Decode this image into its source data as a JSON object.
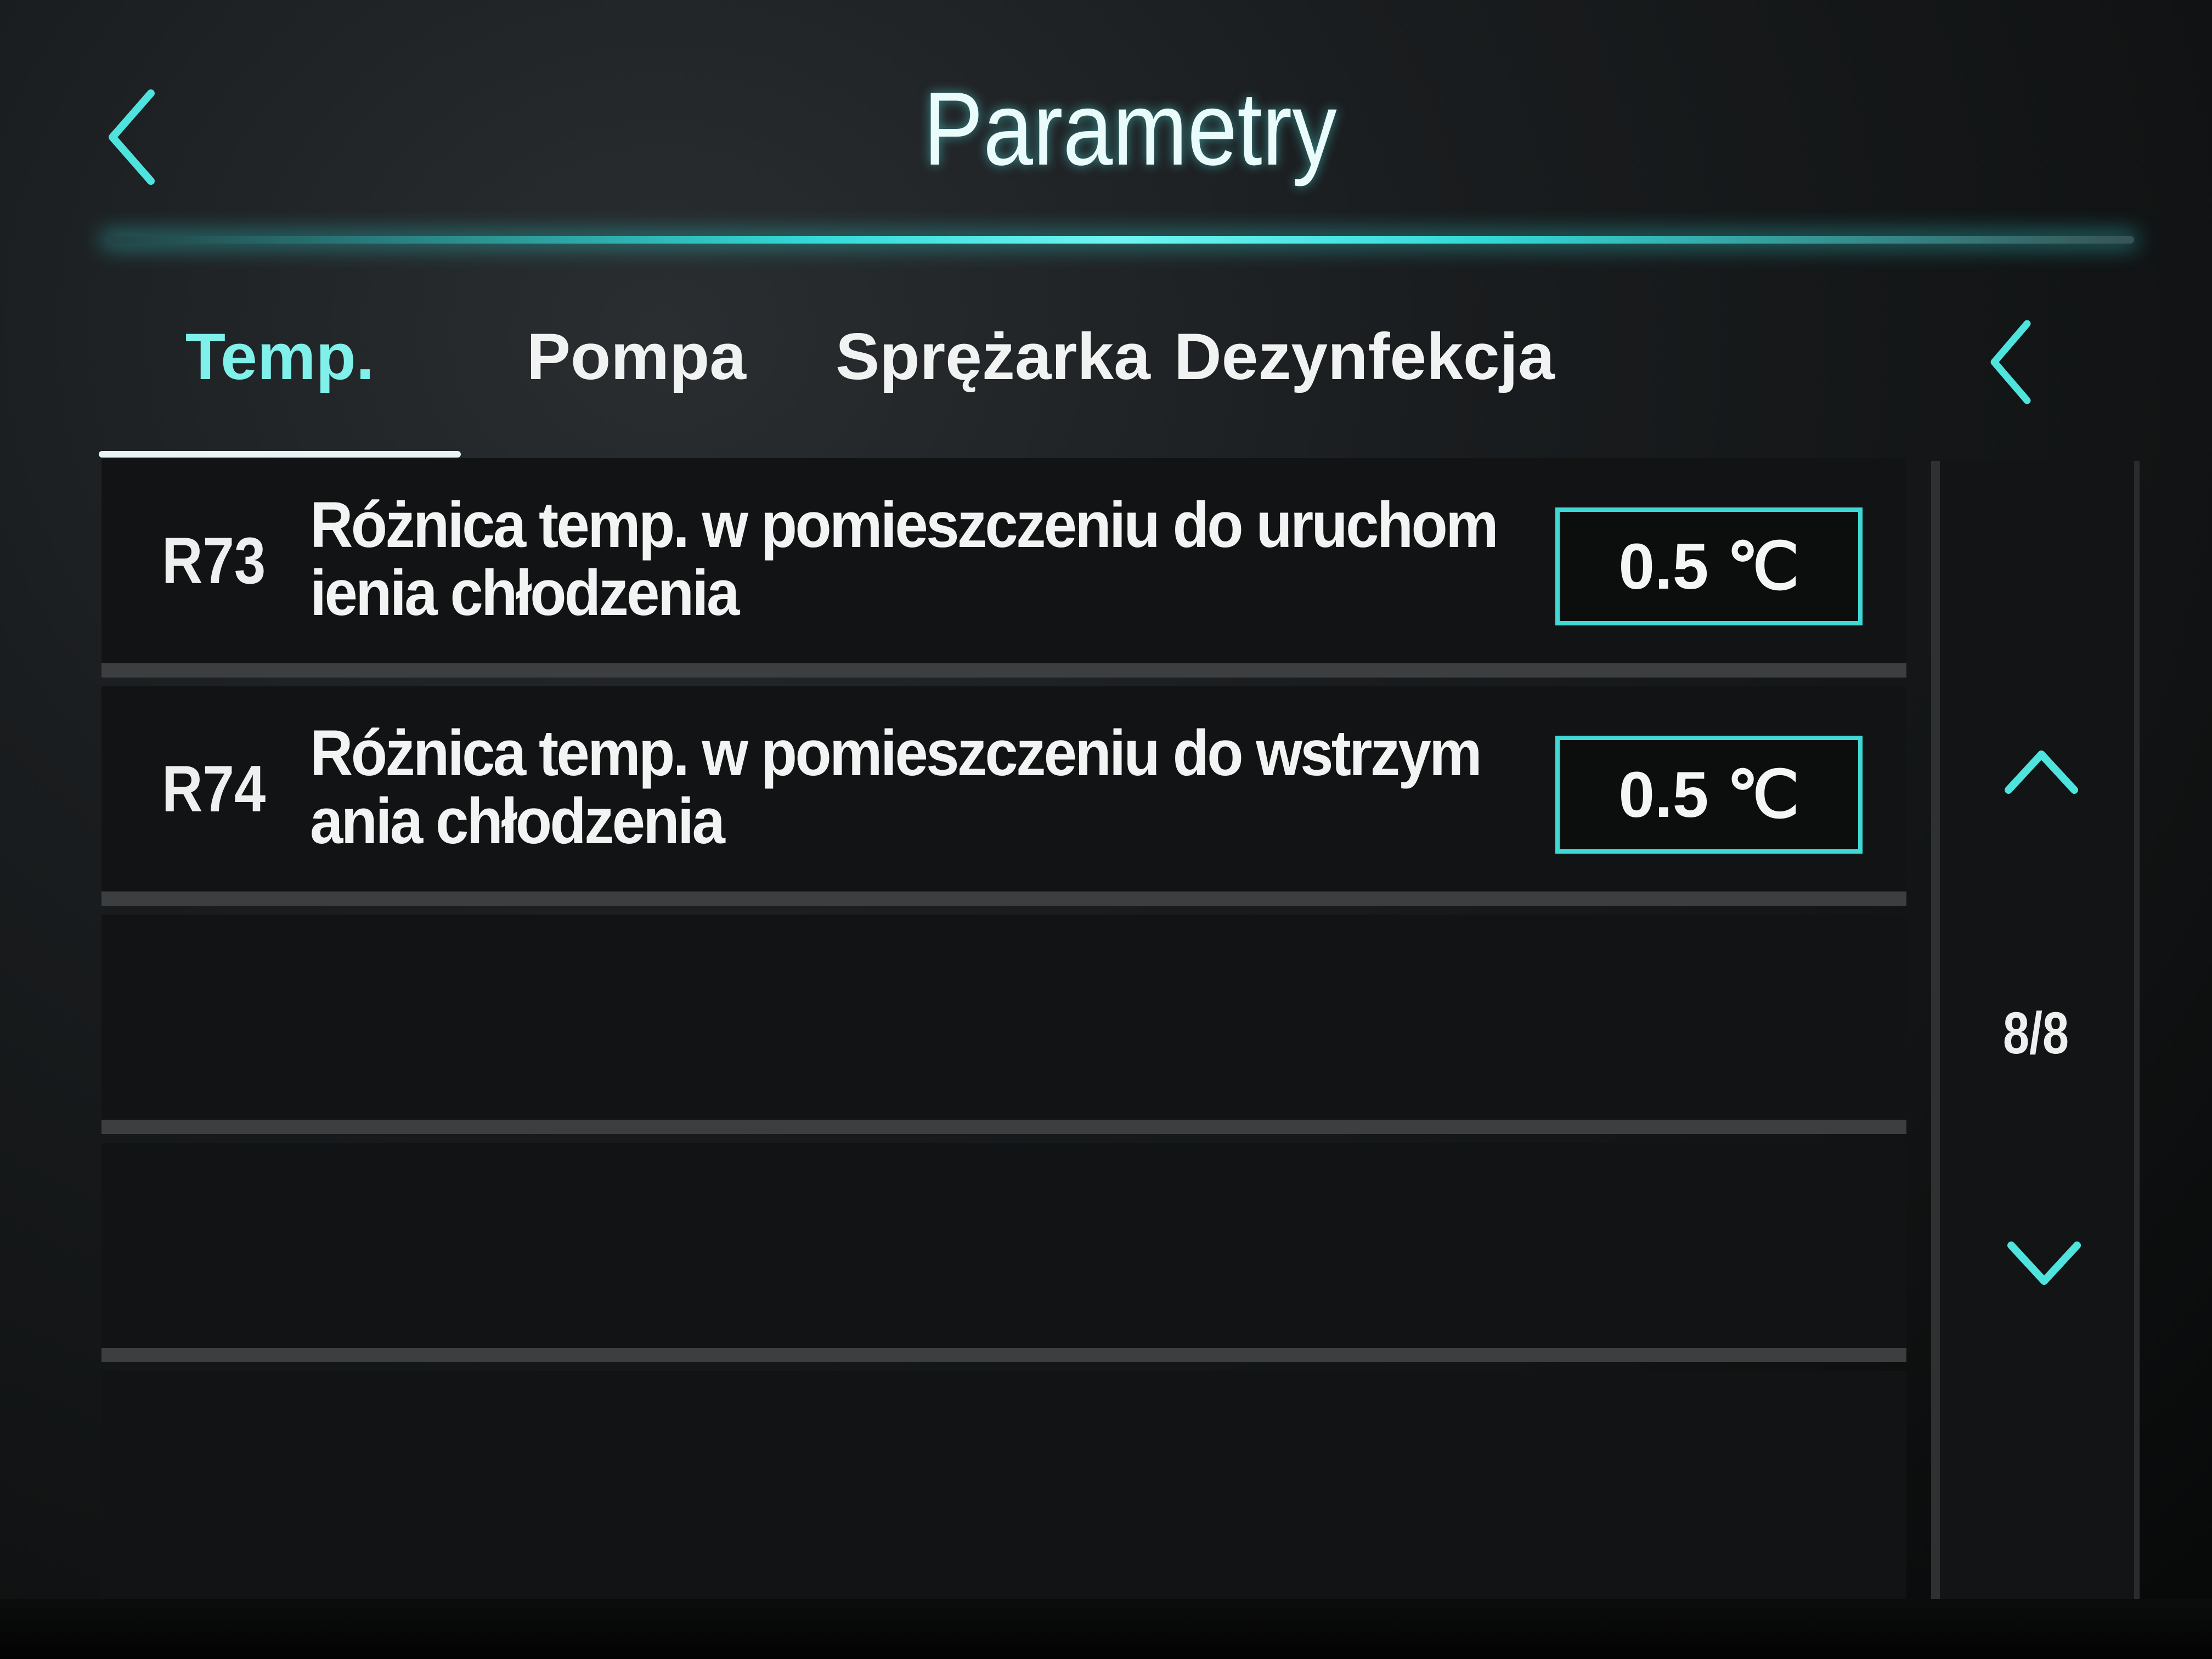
{
  "header": {
    "title": "Parametry",
    "back_icon": "chevron-left-icon"
  },
  "tabs": [
    {
      "label": "Temp.",
      "active": true
    },
    {
      "label": "Pompa",
      "active": false
    },
    {
      "label": "Sprężarka",
      "active": false
    },
    {
      "label": "Dezynfekcja",
      "active": false
    }
  ],
  "tabs_scroll_icon": "chevron-left-icon",
  "parameters": [
    {
      "code": "R73",
      "label": "Różnica temp. w pomieszczeniu do uruchomienia chłodzenia",
      "value": "0.5 ℃"
    },
    {
      "code": "R74",
      "label": "Różnica temp. w pomieszczeniu do wstrzymania chłodzenia",
      "value": "0.5 ℃"
    }
  ],
  "pagination": {
    "current": 8,
    "total": 8,
    "indicator": "8/8",
    "up_icon": "chevron-up-icon",
    "down_icon": "chevron-down-icon"
  },
  "colors": {
    "accent": "#3ed9d4",
    "active_tab": "#7ff0ea",
    "background": "#121314",
    "row_separator": "#3d3e3f"
  }
}
